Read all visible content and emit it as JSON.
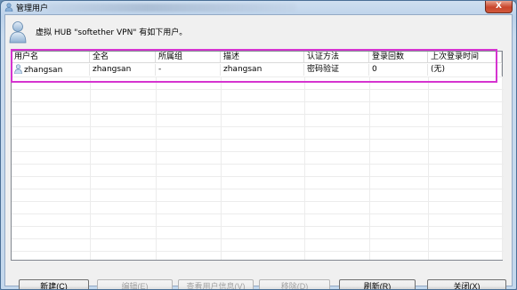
{
  "window": {
    "title": "管理用户",
    "close_glyph": "X"
  },
  "header": {
    "message": "虚拟 HUB \"softether VPN\" 有如下用户。"
  },
  "table": {
    "columns": [
      "用户名",
      "全名",
      "所属组",
      "描述",
      "认证方法",
      "登录回数",
      "上次登录时间"
    ],
    "rows": [
      {
        "username": "zhangsan",
        "fullname": "zhangsan",
        "group": "-",
        "description": "zhangsan",
        "auth": "密码验证",
        "logins": "0",
        "last_login": "(无)"
      }
    ]
  },
  "buttons": {
    "new": "新建(C)",
    "edit": "编辑(E)",
    "view_info": "查看用户信息(V)",
    "remove": "移除(D)",
    "refresh": "刷新(R)",
    "close": "关闭(X)"
  },
  "colors": {
    "selection_frame": "#d534d0",
    "close_button": "#c9462c"
  }
}
